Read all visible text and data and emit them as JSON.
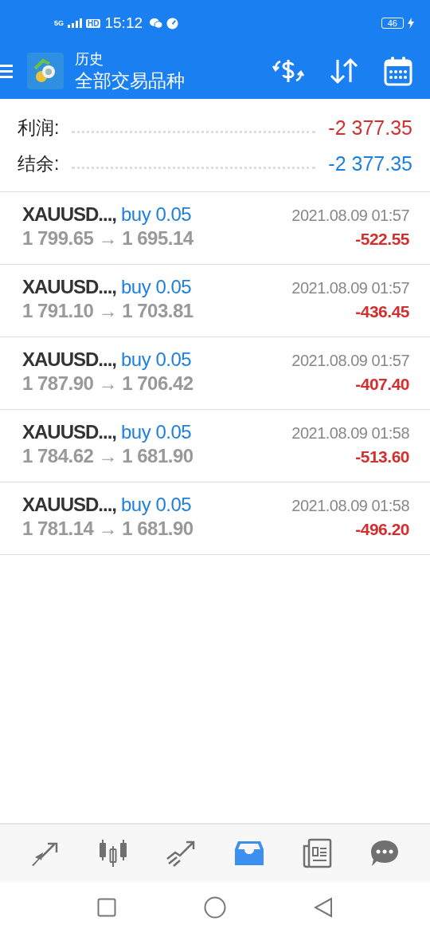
{
  "status_bar": {
    "network": "5G",
    "hd": "HD",
    "time": "15:12",
    "battery": "46"
  },
  "app_bar": {
    "title": "历史",
    "subtitle": "全部交易品种"
  },
  "summary": [
    {
      "label": "利润:",
      "value": "-2 377.35",
      "color": "#d32f2f"
    },
    {
      "label": "结余:",
      "value": "-2 377.35",
      "color": "#1e7fdc"
    }
  ],
  "trades": [
    {
      "symbol": "XAUUSD...,",
      "side": "buy 0.05",
      "prices": "1 799.65 → 1 695.14",
      "time": "2021.08.09 01:57",
      "profit": "-522.55"
    },
    {
      "symbol": "XAUUSD...,",
      "side": "buy 0.05",
      "prices": "1 791.10 → 1 703.81",
      "time": "2021.08.09 01:57",
      "profit": "-436.45"
    },
    {
      "symbol": "XAUUSD...,",
      "side": "buy 0.05",
      "prices": "1 787.90 → 1 706.42",
      "time": "2021.08.09 01:57",
      "profit": "-407.40"
    },
    {
      "symbol": "XAUUSD...,",
      "side": "buy 0.05",
      "prices": "1 784.62 → 1 681.90",
      "time": "2021.08.09 01:58",
      "profit": "-513.60"
    },
    {
      "symbol": "XAUUSD...,",
      "side": "buy 0.05",
      "prices": "1 781.14 → 1 681.90",
      "time": "2021.08.09 01:58",
      "profit": "-496.20"
    }
  ],
  "bottom_nav": [
    {
      "kind": "quotes",
      "selected": false
    },
    {
      "kind": "chart",
      "selected": false
    },
    {
      "kind": "trade",
      "selected": false
    },
    {
      "kind": "history",
      "selected": true
    },
    {
      "kind": "news",
      "selected": false
    },
    {
      "kind": "chat",
      "selected": false
    }
  ]
}
